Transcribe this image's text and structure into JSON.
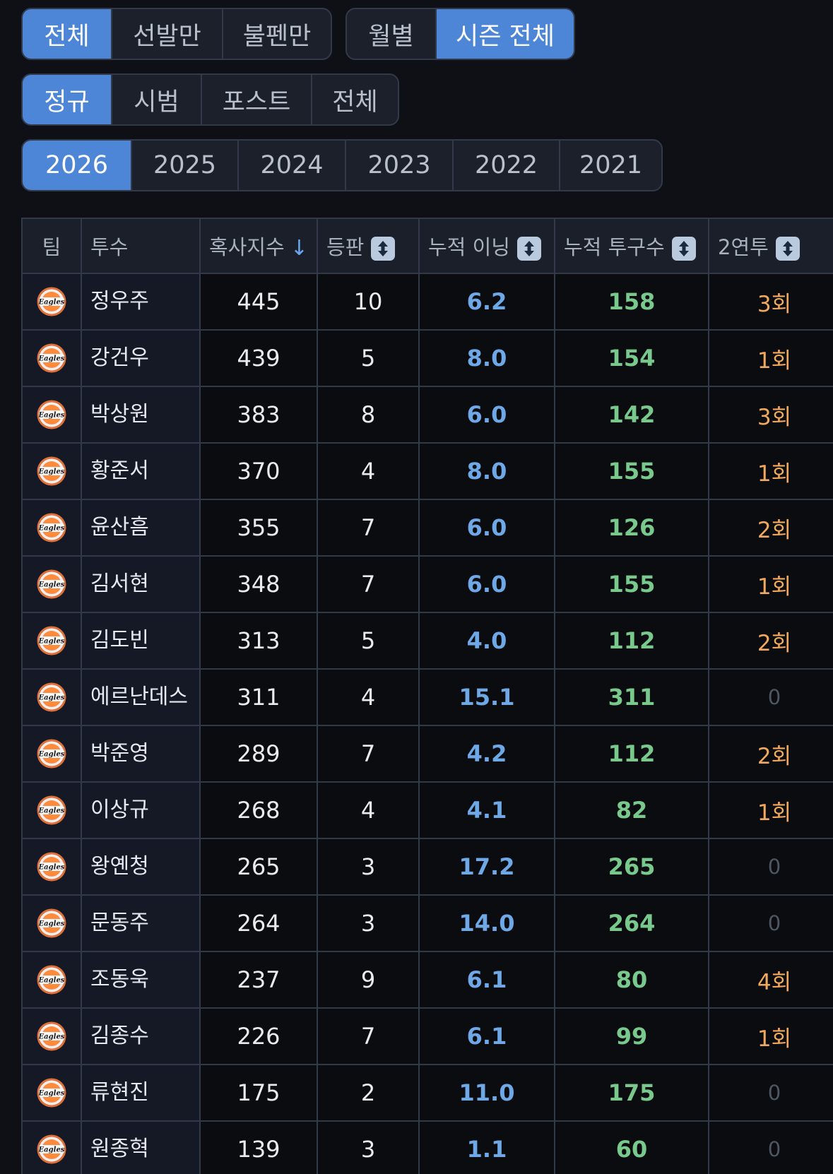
{
  "role_filter": {
    "options": [
      "전체",
      "선발만",
      "불펜만"
    ],
    "active_index": 0
  },
  "period_filter": {
    "options": [
      "월별",
      "시즌 전체"
    ],
    "active_index": 1
  },
  "game_type_filter": {
    "options": [
      "정규",
      "시범",
      "포스트",
      "전체"
    ],
    "active_index": 0
  },
  "year_filter": {
    "options": [
      "2026",
      "2025",
      "2024",
      "2023",
      "2022",
      "2021"
    ],
    "active_index": 0
  },
  "table": {
    "headers": {
      "team": "팀",
      "pitcher": "투수",
      "strain": "혹사지수",
      "appearances": "등판",
      "innings": "누적 이닝",
      "pitches": "누적 투구수",
      "back_to_back": "2연투"
    },
    "sort": {
      "column": "strain",
      "direction": "desc",
      "icon": "arrow-down-icon"
    },
    "team_logo_text": "Eagles",
    "rows": [
      {
        "pitcher": "정우주",
        "strain": "445",
        "appearances": "10",
        "innings": "6.2",
        "pitches": "158",
        "back_to_back": "3회"
      },
      {
        "pitcher": "강건우",
        "strain": "439",
        "appearances": "5",
        "innings": "8.0",
        "pitches": "154",
        "back_to_back": "1회"
      },
      {
        "pitcher": "박상원",
        "strain": "383",
        "appearances": "8",
        "innings": "6.0",
        "pitches": "142",
        "back_to_back": "3회"
      },
      {
        "pitcher": "황준서",
        "strain": "370",
        "appearances": "4",
        "innings": "8.0",
        "pitches": "155",
        "back_to_back": "1회"
      },
      {
        "pitcher": "윤산흠",
        "strain": "355",
        "appearances": "7",
        "innings": "6.0",
        "pitches": "126",
        "back_to_back": "2회"
      },
      {
        "pitcher": "김서현",
        "strain": "348",
        "appearances": "7",
        "innings": "6.0",
        "pitches": "155",
        "back_to_back": "1회"
      },
      {
        "pitcher": "김도빈",
        "strain": "313",
        "appearances": "5",
        "innings": "4.0",
        "pitches": "112",
        "back_to_back": "2회"
      },
      {
        "pitcher": "에르난데스",
        "strain": "311",
        "appearances": "4",
        "innings": "15.1",
        "pitches": "311",
        "back_to_back": "0"
      },
      {
        "pitcher": "박준영",
        "strain": "289",
        "appearances": "7",
        "innings": "4.2",
        "pitches": "112",
        "back_to_back": "2회"
      },
      {
        "pitcher": "이상규",
        "strain": "268",
        "appearances": "4",
        "innings": "4.1",
        "pitches": "82",
        "back_to_back": "1회"
      },
      {
        "pitcher": "왕옌청",
        "strain": "265",
        "appearances": "3",
        "innings": "17.2",
        "pitches": "265",
        "back_to_back": "0"
      },
      {
        "pitcher": "문동주",
        "strain": "264",
        "appearances": "3",
        "innings": "14.0",
        "pitches": "264",
        "back_to_back": "0"
      },
      {
        "pitcher": "조동욱",
        "strain": "237",
        "appearances": "9",
        "innings": "6.1",
        "pitches": "80",
        "back_to_back": "4회"
      },
      {
        "pitcher": "김종수",
        "strain": "226",
        "appearances": "7",
        "innings": "6.1",
        "pitches": "99",
        "back_to_back": "1회"
      },
      {
        "pitcher": "류현진",
        "strain": "175",
        "appearances": "2",
        "innings": "11.0",
        "pitches": "175",
        "back_to_back": "0"
      },
      {
        "pitcher": "원종혁",
        "strain": "139",
        "appearances": "3",
        "innings": "1.1",
        "pitches": "60",
        "back_to_back": "0"
      }
    ]
  },
  "colors": {
    "background": "#0e1016",
    "accent": "#4d86d6",
    "innings": "#6fa8e6",
    "pitches": "#79c98c",
    "back_to_back": "#f1a95e",
    "zero": "#4e5563"
  }
}
